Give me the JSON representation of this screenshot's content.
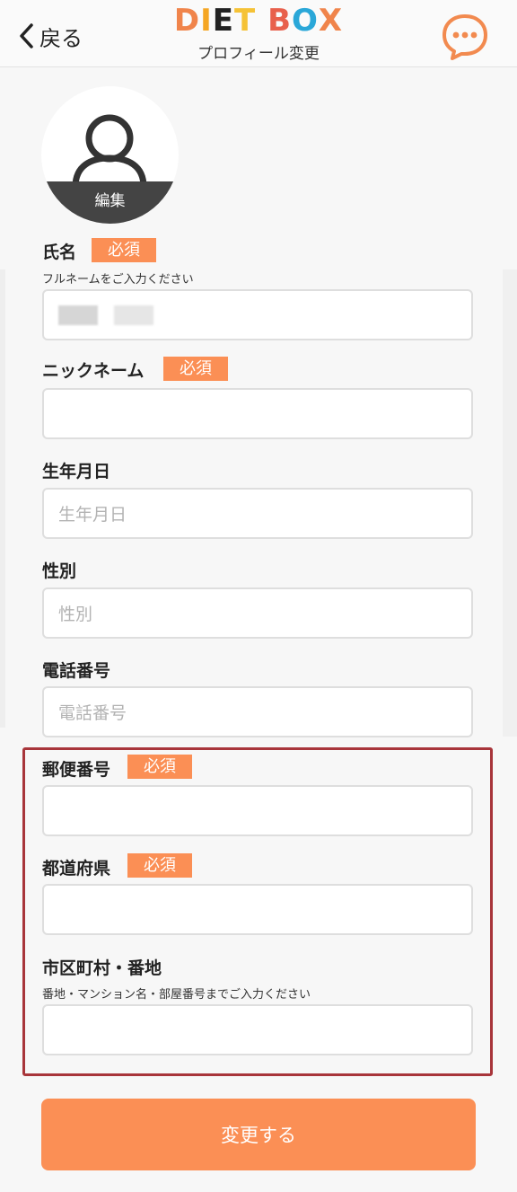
{
  "header": {
    "back_label": "戻る",
    "logo_letters": [
      "D",
      "I",
      "E",
      "T",
      " ",
      "B",
      "O",
      "X"
    ],
    "logo_colors": [
      "#f0844b",
      "#f5a623",
      "#222222",
      "#f5c236",
      "#ffffff",
      "#e8604c",
      "#2aa7d8",
      "#f0844b"
    ],
    "subtitle": "プロフィール変更"
  },
  "avatar": {
    "edit_label": "編集"
  },
  "required_badge": "必須",
  "form": {
    "name": {
      "label": "氏名",
      "hint": "フルネームをご入力ください"
    },
    "nickname": {
      "label": "ニックネーム"
    },
    "birthday": {
      "label": "生年月日",
      "placeholder": "生年月日"
    },
    "gender": {
      "label": "性別",
      "placeholder": "性別"
    },
    "phone": {
      "label": "電話番号",
      "placeholder": "電話番号"
    },
    "postal": {
      "label": "郵便番号"
    },
    "prefecture": {
      "label": "都道府県"
    },
    "address": {
      "label": "市区町村・番地",
      "hint": "番地・マンション名・部屋番号までご入力ください"
    }
  },
  "submit_label": "変更する",
  "colors": {
    "accent": "#fb8f55",
    "highlight_border": "#a8353a"
  }
}
